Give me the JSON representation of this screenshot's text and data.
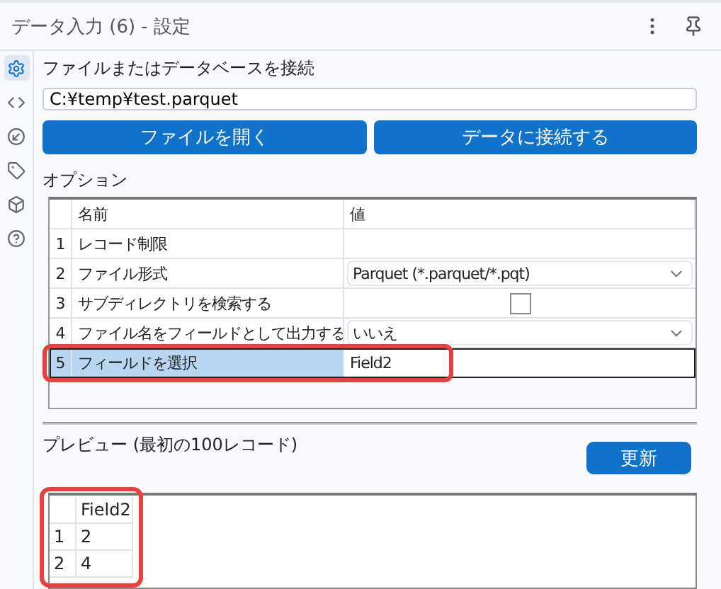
{
  "window": {
    "title": "データ入力 (6) - 設定"
  },
  "sidebar": {
    "items": [
      {
        "selected": true
      },
      {
        "selected": false
      },
      {
        "selected": false
      },
      {
        "selected": false
      },
      {
        "selected": false
      },
      {
        "selected": false
      }
    ]
  },
  "connection": {
    "label": "ファイルまたはデータベースを接続",
    "value": "C:¥temp¥test.parquet",
    "buttons": [
      "ファイルを開く",
      "データに接続する"
    ]
  },
  "options": {
    "label": "オプション",
    "columns": [
      "名前",
      "値"
    ],
    "rows": [
      {
        "number": "1",
        "name": "レコード制限",
        "kind": "text",
        "value": "",
        "selected": false,
        "highlighted": false
      },
      {
        "number": "2",
        "name": "ファイル形式",
        "kind": "dropdown",
        "value": "Parquet (*.parquet/*.pqt)",
        "selected": false,
        "highlighted": false
      },
      {
        "number": "3",
        "name": "サブディレクトリを検索する",
        "kind": "checkbox",
        "checked": false,
        "selected": false,
        "highlighted": false
      },
      {
        "number": "4",
        "name": "ファイル名をフィールドとして出力する",
        "kind": "dropdown",
        "value": "いいえ",
        "selected": false,
        "highlighted": false
      },
      {
        "number": "5",
        "name": "フィールドを選択",
        "kind": "input",
        "value": "Field2",
        "selected": true,
        "highlighted": true
      }
    ]
  },
  "preview": {
    "label": "プレビュー (最初の100レコード)",
    "refresh_button": "更新",
    "highlighted": true,
    "columns": [
      "Field2"
    ],
    "rows": [
      {
        "number": "1",
        "cells": [
          "2"
        ]
      },
      {
        "number": "2",
        "cells": [
          "4"
        ]
      }
    ]
  }
}
